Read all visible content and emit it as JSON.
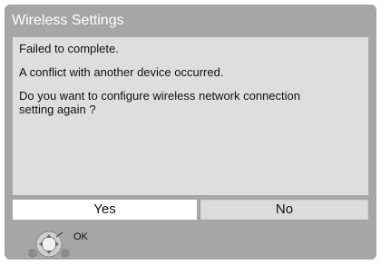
{
  "dialog": {
    "title": "Wireless Settings",
    "messages": [
      "Failed to complete.",
      "A conflict with another device occurred.",
      "Do you want to configure wireless network connection\nsetting again ?"
    ],
    "buttons": {
      "yes_label": "Yes",
      "no_label": "No",
      "selected": "Yes"
    },
    "hint": {
      "icon": "remote-dpad-icon",
      "label": "OK"
    }
  },
  "colors": {
    "dialog_bg": "#a6a6a6",
    "panel_bg": "#dedede",
    "button_bg": "#dcdcdc",
    "button_selected_bg": "#ffffff",
    "title_text": "#ffffff"
  }
}
